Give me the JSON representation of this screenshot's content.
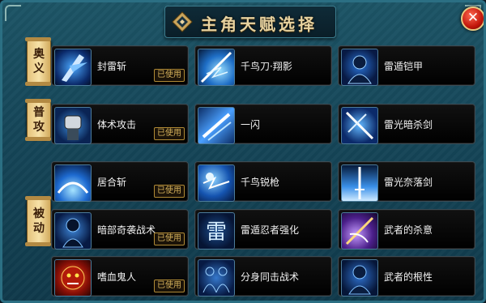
{
  "window": {
    "title": "主角天赋选择",
    "close_label": "✕"
  },
  "categories": [
    {
      "label_1": "奥",
      "label_2": "义"
    },
    {
      "label_1": "普",
      "label_2": "攻"
    },
    {
      "label_1": "被",
      "label_2": "动"
    }
  ],
  "skills": {
    "s1": {
      "name": "封雷斩",
      "badge": "已使用",
      "icon": "lightning-blade-icon"
    },
    "s2": {
      "name": "千鸟刀·翔影",
      "icon": "chidori-slash-icon"
    },
    "s3": {
      "name": "雷遁铠甲",
      "icon": "lightning-armor-icon"
    },
    "s4": {
      "name": "体术攻击",
      "badge": "已使用",
      "icon": "fist-icon"
    },
    "s5": {
      "name": "一闪",
      "icon": "flash-slash-icon"
    },
    "s6": {
      "name": "雷光暗杀剑",
      "icon": "lightning-sword-icon"
    },
    "s7": {
      "name": "居合斩",
      "badge": "已使用",
      "icon": "iai-slash-icon"
    },
    "s8": {
      "name": "千鸟锐枪",
      "icon": "chidori-spear-icon"
    },
    "s9": {
      "name": "雷光奈落剑",
      "icon": "lightning-abyss-sword-icon"
    },
    "s10": {
      "name": "暗部奇袭战术",
      "badge": "已使用",
      "icon": "anbu-silhouette-icon"
    },
    "s11": {
      "name": "雷遁忍者强化",
      "icon": "thunder-glyph-icon"
    },
    "s12": {
      "name": "武者的杀意",
      "icon": "purple-blade-icon"
    },
    "s13": {
      "name": "嗜血鬼人",
      "badge": "已使用",
      "icon": "demon-face-icon"
    },
    "s14": {
      "name": "分身同击战术",
      "icon": "twin-clones-icon"
    },
    "s15": {
      "name": "武者的根性",
      "icon": "warrior-silhouette-icon"
    }
  },
  "colors": {
    "panel": "#1d5566",
    "title_gold": "#e8d3a0",
    "badge_gold": "#d7b35c",
    "close_red": "#c2170b"
  }
}
